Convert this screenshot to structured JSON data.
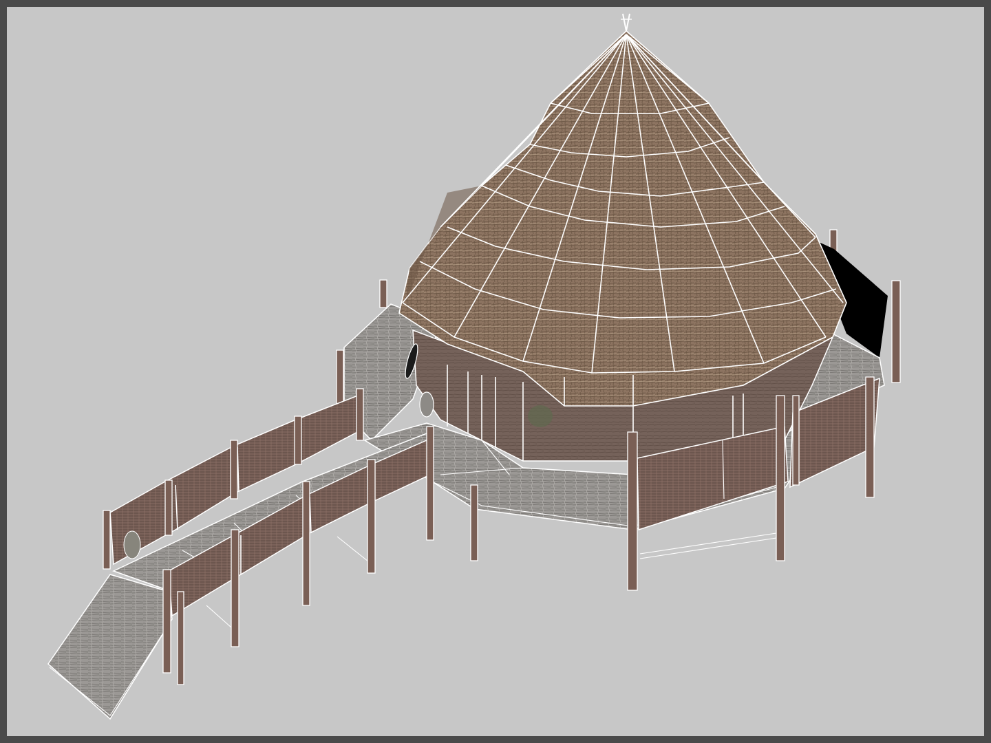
{
  "viewport": {
    "name": "perspective-viewport",
    "background": "#c7c7c7",
    "frame_color": "#4a4a4a"
  },
  "render": {
    "shading": "textured-with-wireframe-overlay",
    "wire_color": "#ffffff"
  },
  "materials": {
    "thatch": "#8e7560",
    "thatch_dark": "#6c5746",
    "deck": "#9a9794",
    "deck_dark": "#7e7b78",
    "woven_wall": "#7a6159",
    "woven_wall_dark": "#5d4943",
    "post": "#7a5f55",
    "shadow": "#000000"
  },
  "model": {
    "object": "thatched-round-hut",
    "parts": [
      "conical-thatch-roof",
      "round-wall",
      "deck-platform",
      "woven-railing",
      "walkway",
      "ramp",
      "support-posts"
    ]
  }
}
